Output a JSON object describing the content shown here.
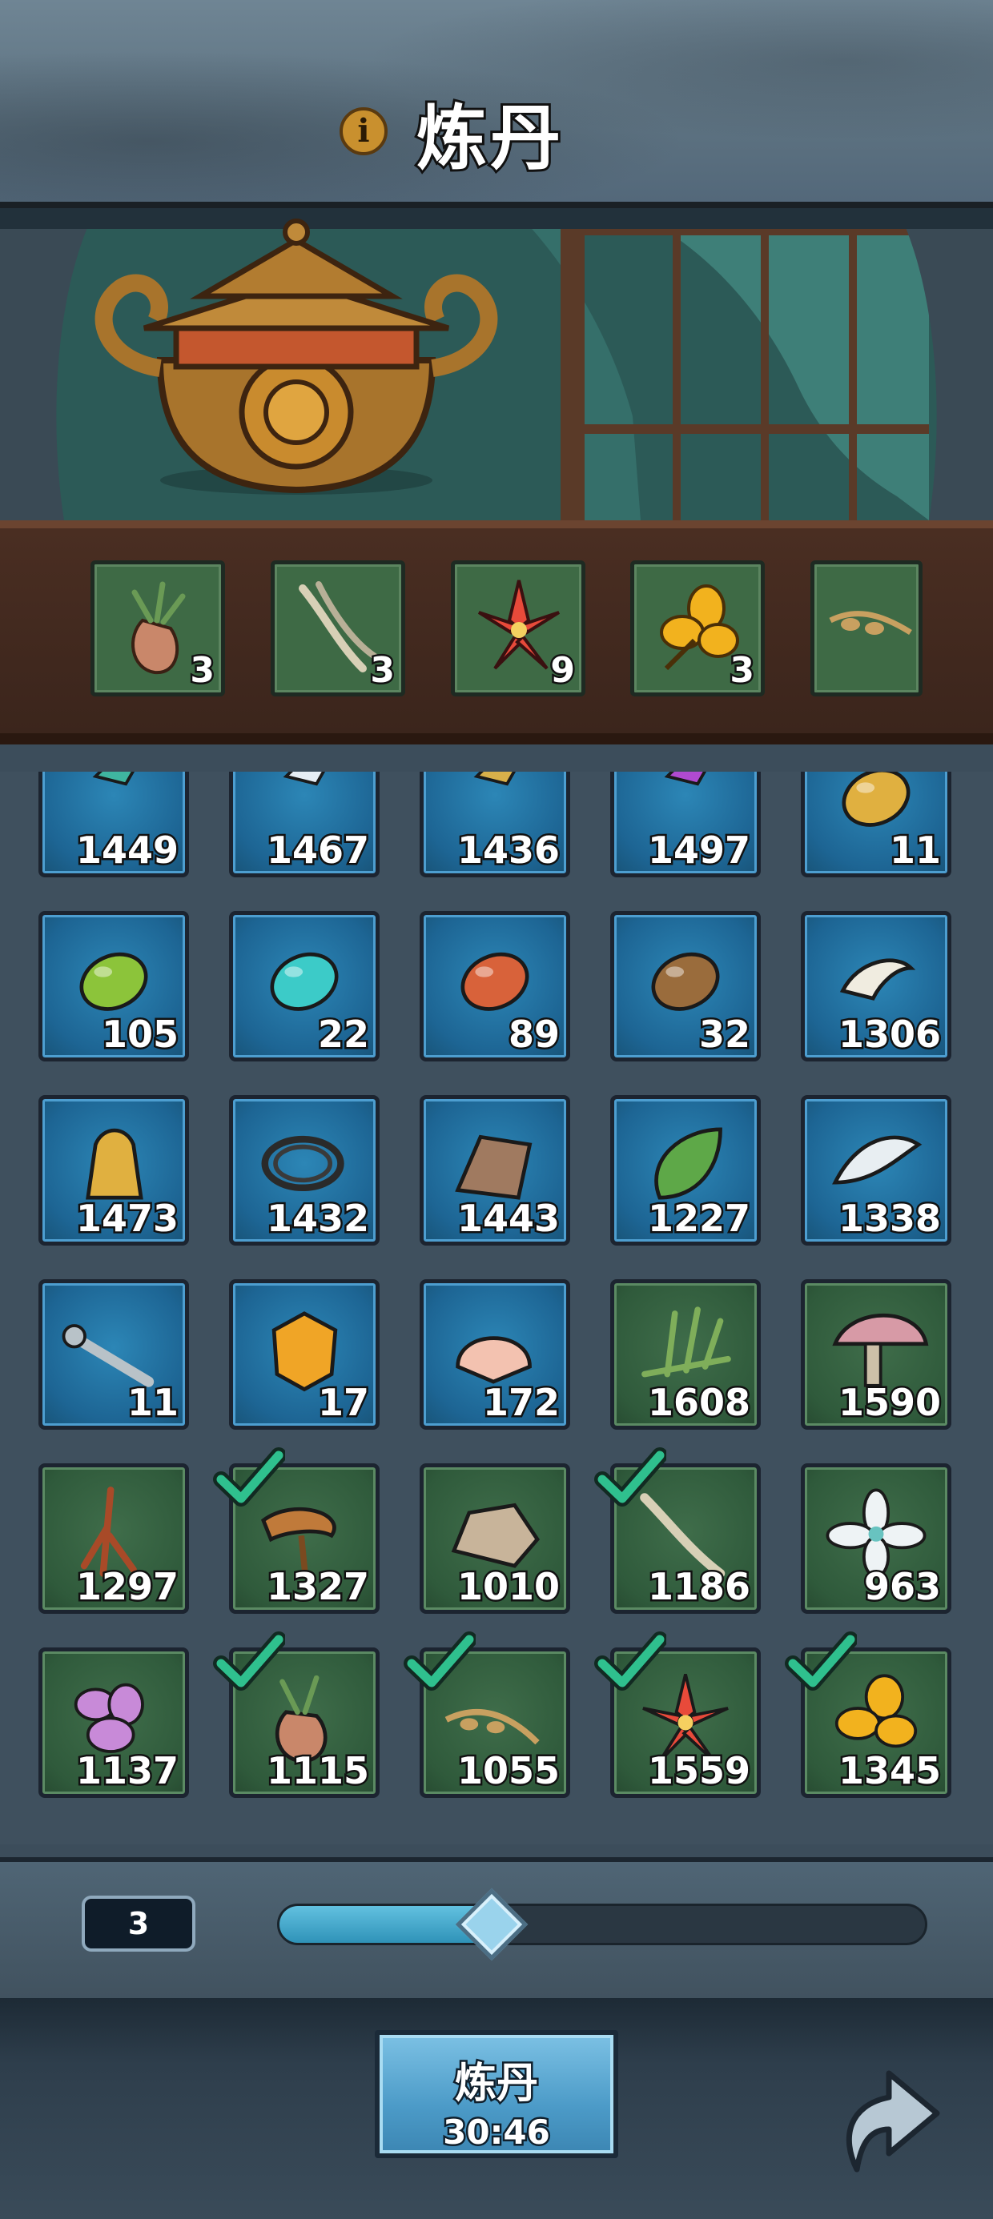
{
  "header": {
    "title": "炼丹",
    "info_icon": "info-icon"
  },
  "selected_slots": [
    {
      "icon": "ginseng-root-icon",
      "count": "3"
    },
    {
      "icon": "bone-twig-icon",
      "count": "3"
    },
    {
      "icon": "red-lily-flower-icon",
      "count": "9"
    },
    {
      "icon": "yellow-flower-icon",
      "count": "3"
    },
    {
      "icon": "seed-pod-icon",
      "count": ""
    }
  ],
  "inventory_rows": [
    [
      {
        "icon": "feather-quill-teal-icon",
        "count": "1449",
        "bg": "blue"
      },
      {
        "icon": "feather-quill-white-icon",
        "count": "1467",
        "bg": "blue"
      },
      {
        "icon": "feather-quill-gold-icon",
        "count": "1436",
        "bg": "blue"
      },
      {
        "icon": "feather-quill-purple-icon",
        "count": "1497",
        "bg": "blue"
      },
      {
        "icon": "gold-stone-icon",
        "count": "11",
        "bg": "blue"
      }
    ],
    [
      {
        "icon": "green-stone-icon",
        "count": "105",
        "bg": "blue"
      },
      {
        "icon": "cyan-stone-icon",
        "count": "22",
        "bg": "blue"
      },
      {
        "icon": "orange-stone-icon",
        "count": "89",
        "bg": "blue"
      },
      {
        "icon": "brown-stone-icon",
        "count": "32",
        "bg": "blue"
      },
      {
        "icon": "horn-icon",
        "count": "1306",
        "bg": "blue"
      }
    ],
    [
      {
        "icon": "golden-relic-icon",
        "count": "1473",
        "bg": "blue"
      },
      {
        "icon": "rope-coil-icon",
        "count": "1432",
        "bg": "blue"
      },
      {
        "icon": "leather-hide-icon",
        "count": "1443",
        "bg": "blue"
      },
      {
        "icon": "leaf-icon",
        "count": "1227",
        "bg": "blue"
      },
      {
        "icon": "white-feather-icon",
        "count": "1338",
        "bg": "blue"
      }
    ],
    [
      {
        "icon": "bone-club-icon",
        "count": "11",
        "bg": "blue"
      },
      {
        "icon": "amber-crystal-icon",
        "count": "17",
        "bg": "blue"
      },
      {
        "icon": "seashell-icon",
        "count": "172",
        "bg": "blue"
      },
      {
        "icon": "grass-herb-icon",
        "count": "1608",
        "bg": "green"
      },
      {
        "icon": "pink-mushroom-icon",
        "count": "1590",
        "bg": "green"
      }
    ],
    [
      {
        "icon": "red-root-icon",
        "count": "1297",
        "bg": "green"
      },
      {
        "icon": "lingzhi-mushroom-icon",
        "count": "1327",
        "bg": "green",
        "checked": true
      },
      {
        "icon": "rock-ore-icon",
        "count": "1010",
        "bg": "green"
      },
      {
        "icon": "bone-twig-icon",
        "count": "1186",
        "bg": "green",
        "checked": true
      },
      {
        "icon": "white-lotus-icon",
        "count": "963",
        "bg": "green"
      }
    ],
    [
      {
        "icon": "purple-flower-icon",
        "count": "1137",
        "bg": "green"
      },
      {
        "icon": "ginseng-root-icon",
        "count": "1115",
        "bg": "green",
        "checked": true
      },
      {
        "icon": "seed-pod-icon",
        "count": "1055",
        "bg": "green",
        "checked": true
      },
      {
        "icon": "red-lily-flower-icon",
        "count": "1559",
        "bg": "green",
        "checked": true
      },
      {
        "icon": "yellow-flower-icon",
        "count": "1345",
        "bg": "green",
        "checked": true
      }
    ]
  ],
  "quantity": {
    "value": "3",
    "fraction": 0.33
  },
  "refine_button": {
    "label": "炼丹",
    "timer": "30:46"
  },
  "back_icon": "back-arrow-icon"
}
